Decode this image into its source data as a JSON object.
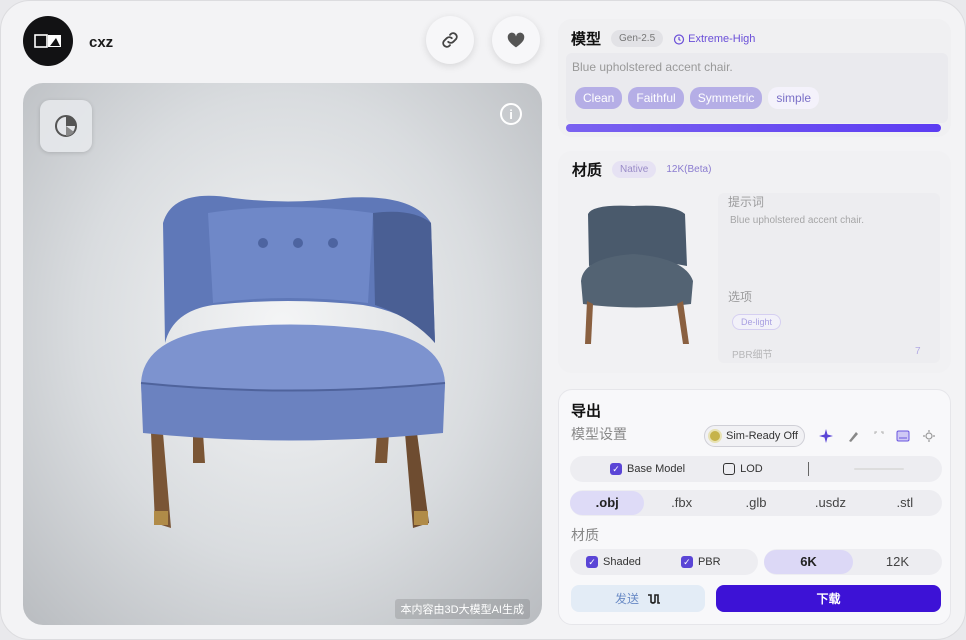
{
  "header": {
    "username": "cxz",
    "link_icon": "link-icon",
    "favorite_icon": "heart-icon"
  },
  "viewer": {
    "watermark": "本内容由3D大模型AI生成",
    "info_label": "i"
  },
  "model": {
    "title": "模型",
    "gen_chip": "Gen-2.5",
    "quality_label": "Extreme-High",
    "prompt": "Blue upholstered accent chair.",
    "pills": [
      "Clean",
      "Faithful",
      "Symmetric",
      "simple"
    ],
    "progress": 1.0
  },
  "material": {
    "title": "材质",
    "native_chip": "Native",
    "res_label": "12K(Beta)",
    "prompt_label": "提示词",
    "prompt": "Blue upholstered accent chair.",
    "options_label": "选项",
    "delight_chip": "De-light",
    "pbr_detail_label": "PBR细节",
    "pbr_detail_value": "7"
  },
  "export": {
    "title": "导出",
    "model_settings_label": "模型设置",
    "simready_label": "Sim-Ready Off",
    "base_model_label": "Base Model",
    "lod_label": "LOD",
    "formats": [
      ".obj",
      ".fbx",
      ".glb",
      ".usdz",
      ".stl"
    ],
    "active_format": ".obj",
    "material_label": "材质",
    "shaded_label": "Shaded",
    "pbr_label": "PBR",
    "resolutions": [
      "6K",
      "12K"
    ],
    "active_resolution": "6K",
    "send_label": "发送",
    "download_label": "下载"
  },
  "colors": {
    "accent": "#3d12d6",
    "progress": "#6a4ff0",
    "chair_blue": "#6f86c4"
  }
}
